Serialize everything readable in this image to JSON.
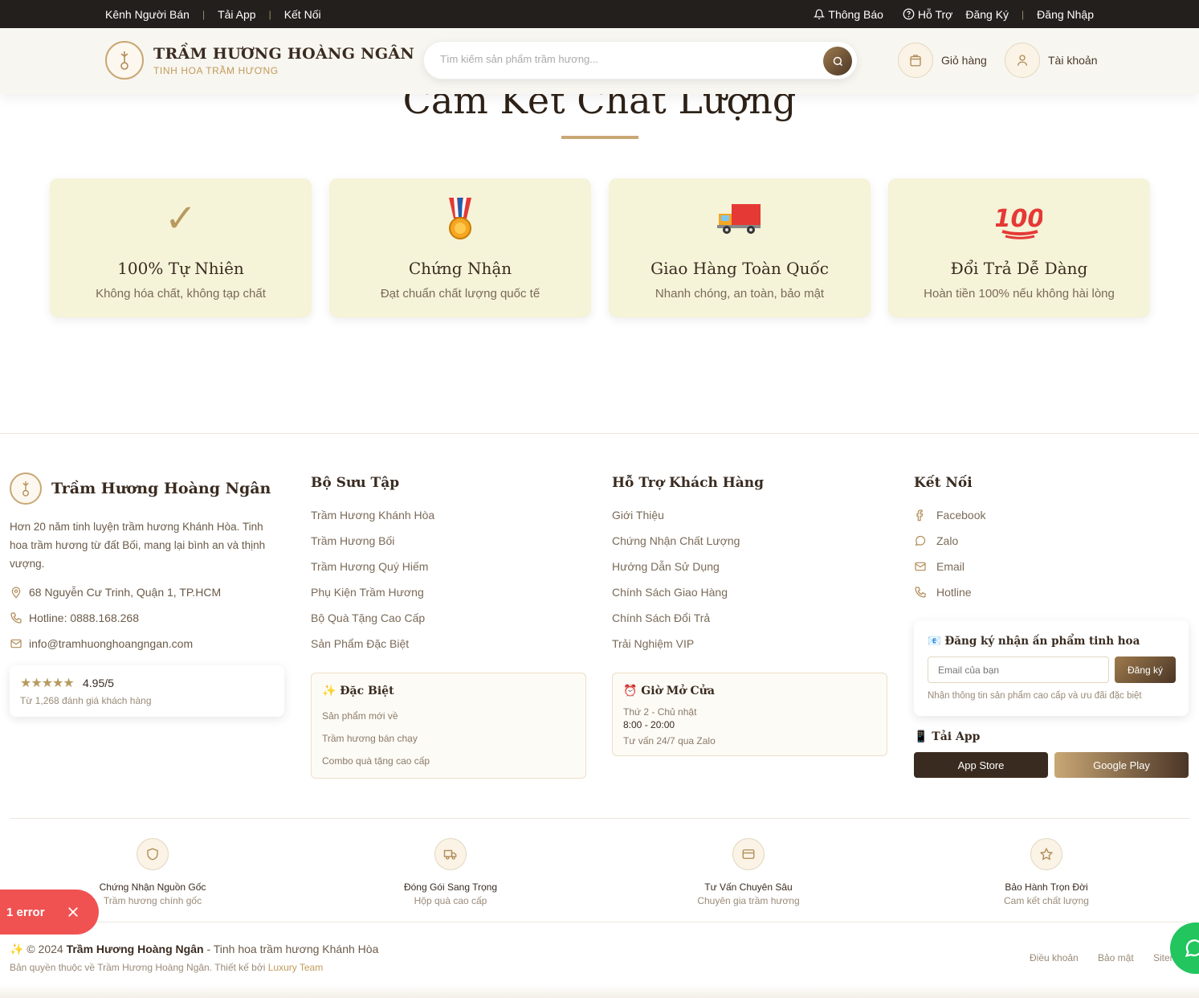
{
  "topbar": {
    "left": [
      "Kênh Người Bán",
      "Tải App",
      "Kết Nối"
    ],
    "notify": "Thông Báo",
    "help": "Hỗ Trợ",
    "register": "Đăng Ký",
    "login": "Đăng Nhập"
  },
  "header": {
    "brand": "TRẦM HƯƠNG HOÀNG NGÂN",
    "tagline": "TINH HOA TRẦM HƯƠNG",
    "search_placeholder": "Tìm kiếm sản phẩm trầm hương...",
    "cart": "Giỏ hàng",
    "account": "Tài khoản"
  },
  "commitment": {
    "title": "Cam Kết Chất Lượng",
    "cards": [
      {
        "icon": "checkmark-icon",
        "glyph": "✓",
        "title": "100% Tự Nhiên",
        "desc": "Không hóa chất, không tạp chất"
      },
      {
        "icon": "medal-icon",
        "glyph": "🎖",
        "title": "Chứng Nhận",
        "desc": "Đạt chuẩn chất lượng quốc tế"
      },
      {
        "icon": "truck-icon",
        "glyph": "🚚",
        "title": "Giao Hàng Toàn Quốc",
        "desc": "Nhanh chóng, an toàn, bảo mật"
      },
      {
        "icon": "hundred-points-icon",
        "glyph": "💯",
        "title": "Đổi Trả Dễ Dàng",
        "desc": "Hoàn tiền 100% nếu không hài lòng"
      }
    ]
  },
  "footer": {
    "brand": "Trầm Hương Hoàng Ngân",
    "desc": "Hơn 20 năm tinh luyện trầm hương Khánh Hòa. Tinh hoa trầm hương từ đất Bối, mang lại bình an và thịnh vượng.",
    "address": "68 Nguyễn Cư Trinh, Quận 1, TP.HCM",
    "hotline": "Hotline: 0888.168.268",
    "email": "info@tramhuonghoangngan.com",
    "rating": {
      "stars": "★★★★★",
      "score": "4.95/5",
      "note": "Từ 1,268 đánh giá khách hàng"
    },
    "collection": {
      "title": "Bộ Sưu Tập",
      "links": [
        "Trầm Hương Khánh Hòa",
        "Trầm Hương Bối",
        "Trầm Hương Quý Hiếm",
        "Phụ Kiện Trầm Hương",
        "Bộ Quà Tặng Cao Cấp",
        "Sản Phẩm Đặc Biệt"
      ],
      "special_title": "✨ Đặc Biệt",
      "special": [
        "Sản phẩm mới về",
        "Trầm hương bán chạy",
        "Combo quà tặng cao cấp"
      ]
    },
    "support": {
      "title": "Hỗ Trợ Khách Hàng",
      "links": [
        "Giới Thiệu",
        "Chứng Nhận Chất Lượng",
        "Hướng Dẫn Sử Dụng",
        "Chính Sách Giao Hàng",
        "Chính Sách Đổi Trả",
        "Trải Nghiệm VIP"
      ],
      "hours_title": "⏰ Giờ Mở Cửa",
      "days": "Thứ 2 - Chủ nhật",
      "hours": "8:00 - 20:00",
      "consult": "Tư vấn 24/7 qua Zalo"
    },
    "connect": {
      "title": "Kết Nối",
      "links": [
        "Facebook",
        "Zalo",
        "Email",
        "Hotline"
      ],
      "newsletter_title": "📧 Đăng ký nhận ấn phẩm tinh hoa",
      "email_placeholder": "Email của bạn",
      "subscribe": "Đăng ký",
      "newsletter_note": "Nhận thông tin sản phẩm cao cấp và ưu đãi đặc biệt",
      "app_title": "📱 Tải App",
      "app_store": "App Store",
      "google_play": "Google Play"
    },
    "features": [
      {
        "icon": "shield-icon",
        "title": "Chứng Nhận Nguồn Gốc",
        "sub": "Trầm hương chính gốc"
      },
      {
        "icon": "truck-icon",
        "title": "Đóng Gói Sang Trọng",
        "sub": "Hộp quà cao cấp"
      },
      {
        "icon": "card-icon",
        "title": "Tư Vấn Chuyên Sâu",
        "sub": "Chuyên gia trầm hương"
      },
      {
        "icon": "star-icon",
        "title": "Bảo Hành Trọn Đời",
        "sub": "Cam kết chất lượng"
      }
    ],
    "copyright_pre": "✨ © 2024 ",
    "copyright_brand": "Trầm Hương Hoàng Ngân",
    "copyright_post": " - Tinh hoa trầm hương Khánh Hòa",
    "rights_pre": "Bản quyền thuộc về Trầm Hương Hoàng Ngân. Thiết kế bởi ",
    "rights_team": "Luxury Team",
    "bottom_links": [
      "Điều khoản",
      "Bảo mật",
      "Sitemap"
    ]
  },
  "error_toast": "1 error",
  "colors": {
    "accent": "#c9a775",
    "dark": "#231f1c",
    "card_bg": "#f5f3d8",
    "error": "#f05252",
    "chat": "#22c55e"
  }
}
